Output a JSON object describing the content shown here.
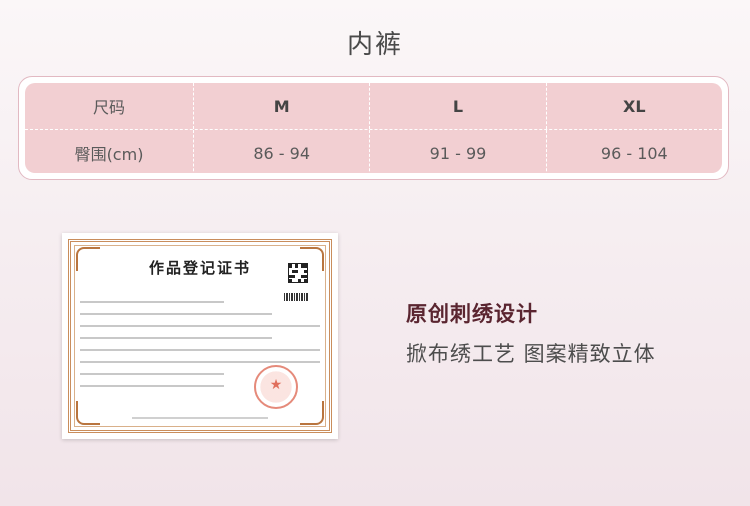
{
  "page": {
    "title": "内裤"
  },
  "size_table": {
    "header": {
      "label": "尺码",
      "sizes": [
        "M",
        "L",
        "XL"
      ]
    },
    "row": {
      "label": "臀围(cm)",
      "values": [
        "86 - 94",
        "91 - 99",
        "96 - 104"
      ]
    }
  },
  "certificate": {
    "title": "作品登记证书"
  },
  "feature": {
    "title": "原创刺绣设计",
    "subtitle": "掀布绣工艺 图案精致立体"
  },
  "colors": {
    "table_fill": "#f2cfd2",
    "table_border": "#e2b9c2",
    "feature_title": "#5a2530"
  }
}
